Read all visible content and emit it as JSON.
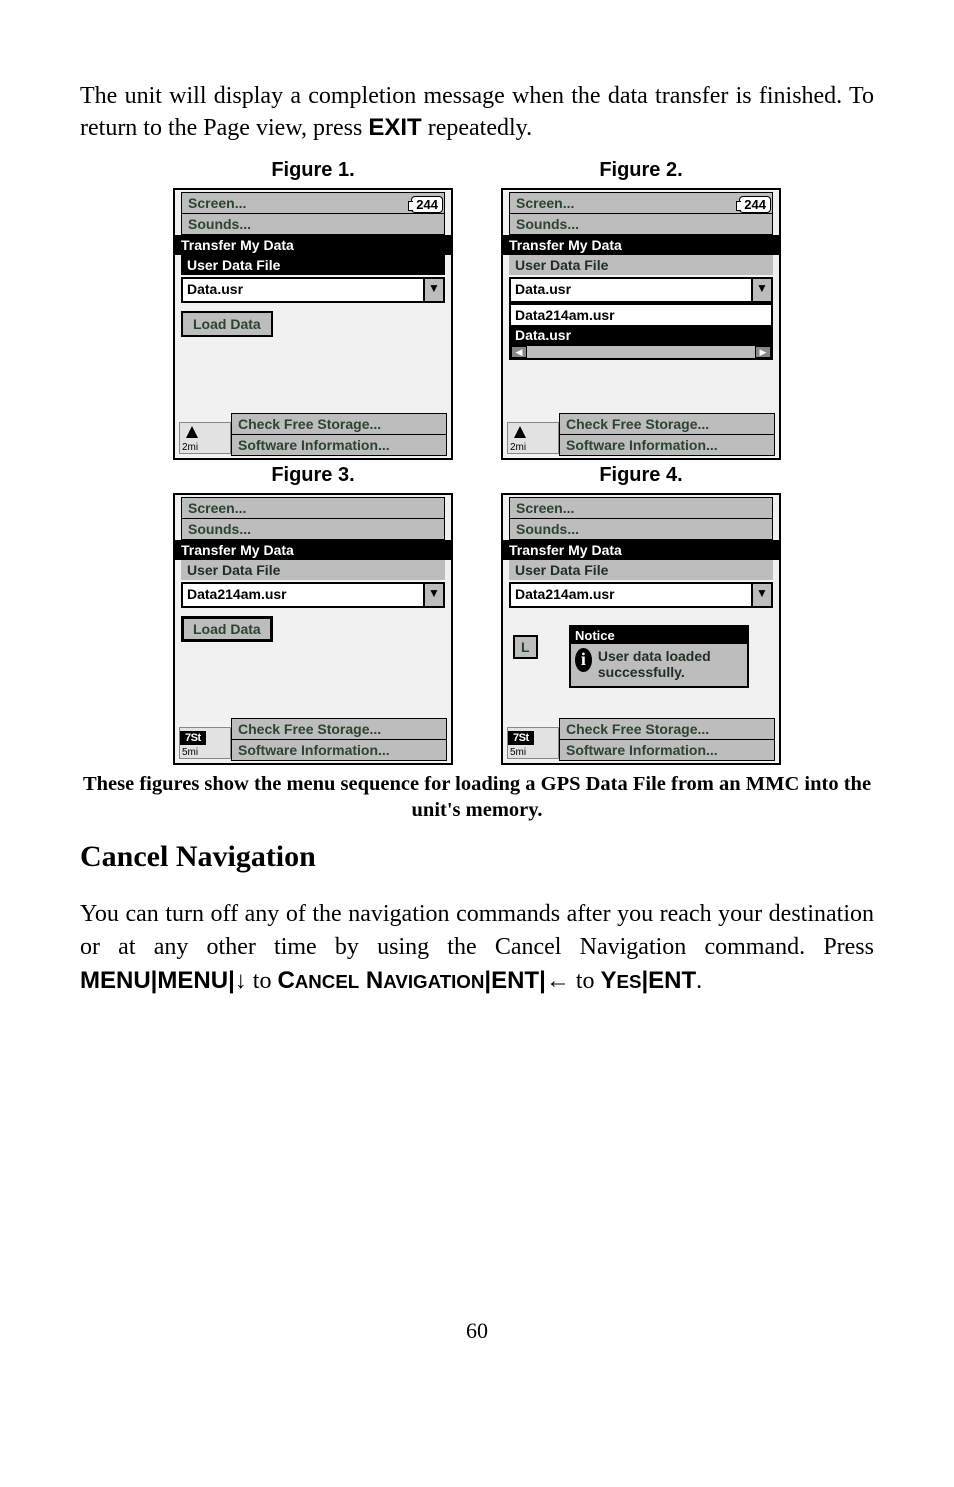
{
  "intro": {
    "text_pre": "The unit will display a completion message when the data transfer is finished. To return to the Page view, press ",
    "exit": "EXIT",
    "text_post": " repeatedly."
  },
  "figures": {
    "f1_title": "Figure 1.",
    "f2_title": "Figure 2.",
    "f3_title": "Figure 3.",
    "f4_title": "Figure 4.",
    "caption": "These figures show the menu sequence for loading a GPS Data File from an MMC into the unit's memory."
  },
  "panel_common": {
    "screen": "Screen...",
    "sounds": "Sounds...",
    "transfer": "Transfer My Data",
    "userfile": "User Data File",
    "check_storage": "Check Free Storage...",
    "software_info": "Software Information...",
    "load_btn": "Load Data",
    "badge": "244",
    "scale2": "2mi",
    "scale5": "5mi"
  },
  "panel1": {
    "file": "Data.usr"
  },
  "panel2": {
    "file": "Data.usr",
    "opt1": "Data214am.usr",
    "opt2": "Data.usr"
  },
  "panel3": {
    "file": "Data214am.usr"
  },
  "panel4": {
    "file": "Data214am.usr",
    "notice_title": "Notice",
    "notice_text": "User data loaded successfully.",
    "behind_L": "L"
  },
  "cancel_nav": {
    "heading": "Cancel Navigation",
    "text_pre": "You can turn off any of the navigation commands after you reach your destination or at any other time by using the Cancel Navigation command. Press ",
    "menu": "MENU",
    "pipe": "|",
    "to": " to ",
    "cancel_big": "C",
    "cancel_rest": "ANCEL",
    "nav_big": "N",
    "nav_rest": "AVIGATION",
    "ent": "ENT",
    "yes_big": "Y",
    "yes_rest": "ES",
    "arrow_down": "↓",
    "arrow_left": "←",
    "period": "."
  },
  "page_number": "60",
  "icons": {
    "st_label": "7St"
  }
}
